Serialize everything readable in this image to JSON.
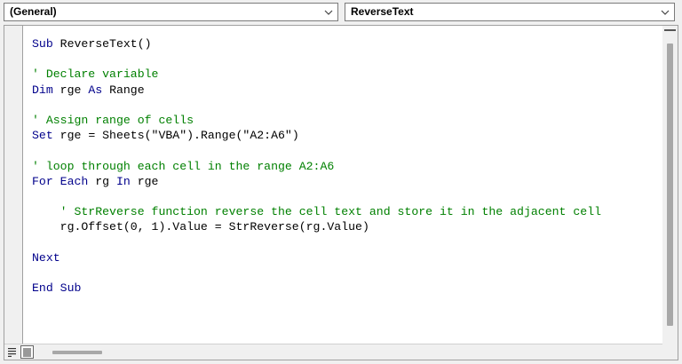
{
  "object_combo": {
    "value": "(General)"
  },
  "procedure_combo": {
    "value": "ReverseText"
  },
  "code_lines": [
    [
      {
        "t": "kw",
        "s": "Sub"
      },
      {
        "t": "tx",
        "s": " ReverseText()"
      }
    ],
    [],
    [
      {
        "t": "cm",
        "s": "' Declare variable"
      }
    ],
    [
      {
        "t": "kw",
        "s": "Dim"
      },
      {
        "t": "tx",
        "s": " rge "
      },
      {
        "t": "kw",
        "s": "As"
      },
      {
        "t": "tx",
        "s": " Range"
      }
    ],
    [],
    [
      {
        "t": "cm",
        "s": "' Assign range of cells"
      }
    ],
    [
      {
        "t": "kw",
        "s": "Set"
      },
      {
        "t": "tx",
        "s": " rge = Sheets(\"VBA\").Range(\"A2:A6\")"
      }
    ],
    [],
    [
      {
        "t": "cm",
        "s": "' loop through each cell in the range A2:A6"
      }
    ],
    [
      {
        "t": "kw",
        "s": "For Each"
      },
      {
        "t": "tx",
        "s": " rg "
      },
      {
        "t": "kw",
        "s": "In"
      },
      {
        "t": "tx",
        "s": " rge"
      }
    ],
    [],
    [
      {
        "t": "cm",
        "s": "    ' StrReverse function reverse the cell text and store it in the adjacent cell"
      }
    ],
    [
      {
        "t": "tx",
        "s": "    rg.Offset(0, 1).Value = StrReverse(rg.Value)"
      }
    ],
    [],
    [
      {
        "t": "kw",
        "s": "Next"
      }
    ],
    [],
    [
      {
        "t": "kw",
        "s": "End Sub"
      }
    ]
  ],
  "icons": {
    "dropdown": "chevron-down-icon",
    "procedure_view": "procedure-view-icon",
    "full_module_view": "full-module-view-icon"
  },
  "colors": {
    "keyword": "#00008b",
    "comment": "#008000",
    "text": "#000000"
  }
}
